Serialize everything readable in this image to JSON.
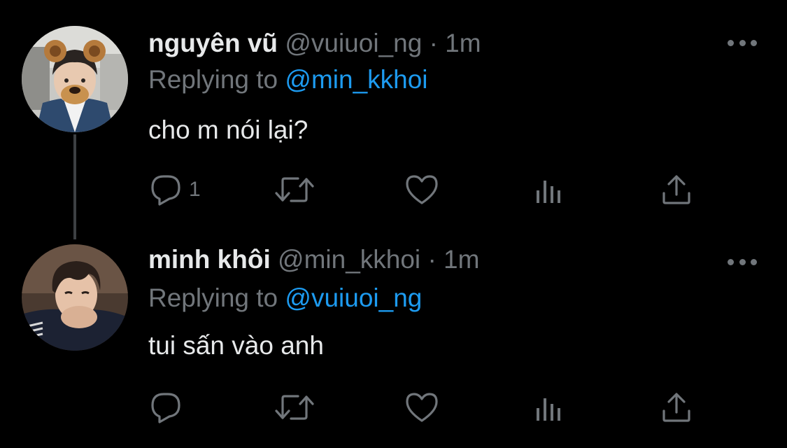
{
  "tweets": [
    {
      "display_name": "nguyên vũ",
      "handle": "@vuiuoi_ng",
      "separator": "·",
      "time": "1m",
      "replying_label": "Replying to",
      "replying_to": "@min_kkhoi",
      "text": "cho m nói lại?",
      "reply_count": "1",
      "retweet_count": "",
      "like_count": "",
      "avatar": "avatar-bear-filter"
    },
    {
      "display_name": "minh khôi",
      "handle": "@min_kkhoi",
      "separator": "·",
      "time": "1m",
      "replying_label": "Replying to",
      "replying_to": "@vuiuoi_ng",
      "text": "tui sấn vào anh",
      "reply_count": "",
      "retweet_count": "",
      "like_count": "",
      "avatar": "avatar-portrait"
    }
  ],
  "icons": {
    "reply": "reply-icon",
    "retweet": "retweet-icon",
    "like": "heart-icon",
    "analytics": "analytics-icon",
    "share": "share-icon",
    "more": "more-icon"
  },
  "colors": {
    "background": "#000000",
    "text_primary": "#e7e9ea",
    "text_secondary": "#71767b",
    "accent": "#1d9bf0",
    "thread_line": "#3d4043"
  }
}
